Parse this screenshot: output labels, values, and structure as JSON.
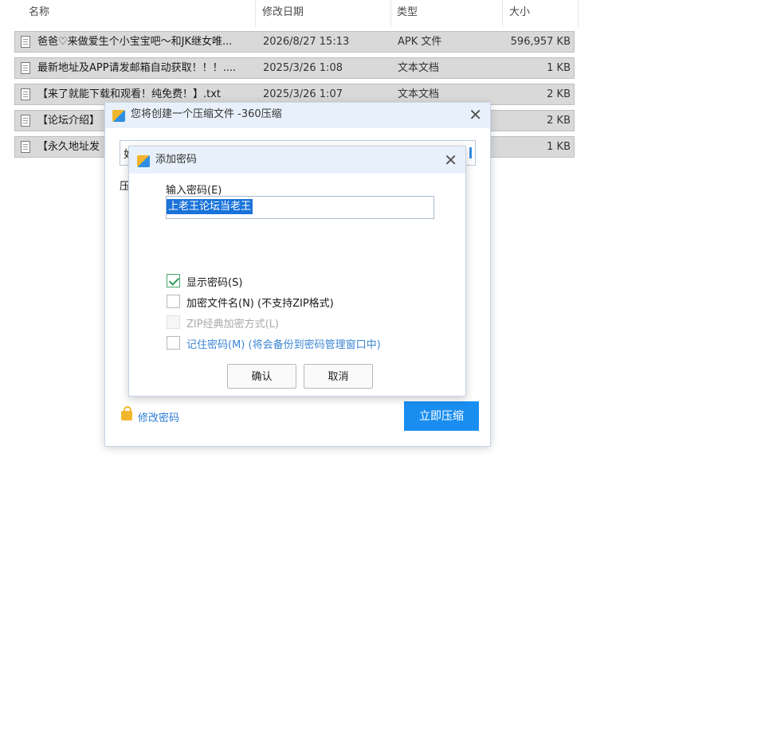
{
  "explorer": {
    "columns": {
      "name": "名称",
      "date": "修改日期",
      "type": "类型",
      "size": "大小"
    },
    "files": [
      {
        "name": "爸爸♡来做爱生个小宝宝吧～和JK继女唯...",
        "date": "2026/8/27 15:13",
        "type": "APK 文件",
        "size": "596,957 KB"
      },
      {
        "name": "最新地址及APP请发邮箱自动获取！！！....",
        "date": "2025/3/26 1:08",
        "type": "文本文档",
        "size": "1 KB"
      },
      {
        "name": "【来了就能下载和观看！纯免费！】.txt",
        "date": "2025/3/26 1:07",
        "type": "文本文档",
        "size": "2 KB"
      },
      {
        "name": "【论坛介绍】",
        "date": "",
        "type": "",
        "size": "2 KB"
      },
      {
        "name": "【永久地址发",
        "date": "",
        "type": "",
        "size": "1 KB"
      }
    ]
  },
  "compress_dialog": {
    "title": "您将创建一个压缩文件 -360压缩",
    "field_partial": "如",
    "label_partial": "压",
    "change_password_link": "修改密码",
    "compress_button": "立即压缩"
  },
  "password_dialog": {
    "title": "添加密码",
    "input_label": "输入密码(E)",
    "password_value": "上老王论坛当老王",
    "options": [
      {
        "label": "显示密码(S)",
        "note": "",
        "checked": true,
        "disabled": false
      },
      {
        "label": "加密文件名(N)",
        "note": " (不支持ZIP格式)",
        "checked": false,
        "disabled": false
      },
      {
        "label": "ZIP经典加密方式(L)",
        "note": "",
        "checked": false,
        "disabled": true
      },
      {
        "label": "记住密码(M)",
        "note": " (将会备份到密码管理窗口中)",
        "checked": false,
        "disabled": false
      }
    ],
    "ok_button": "确认",
    "cancel_button": "取消"
  }
}
